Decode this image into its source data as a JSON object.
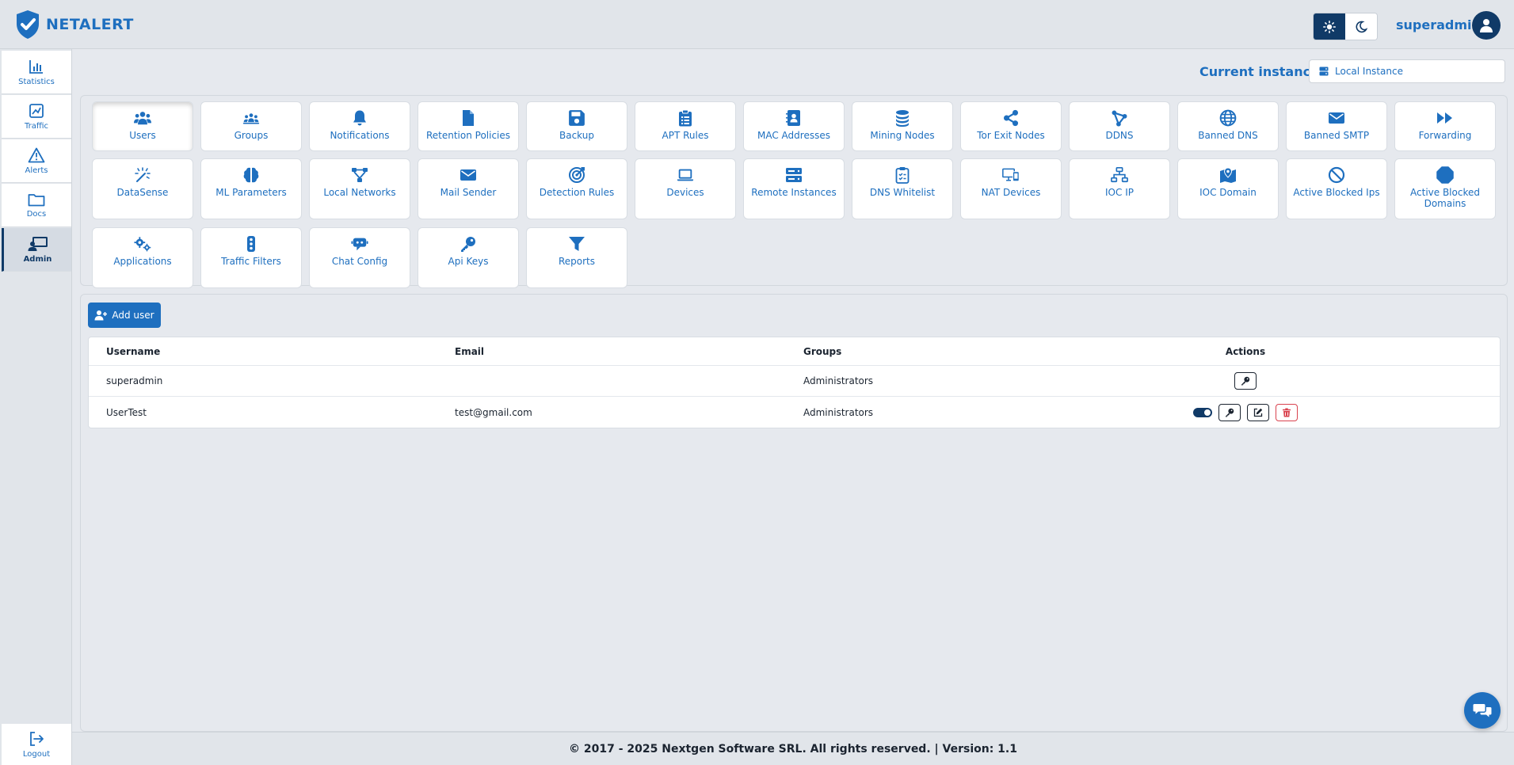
{
  "app": {
    "logo_text": "NETALERT"
  },
  "header": {
    "username": "superadmin"
  },
  "sidebar": {
    "items": [
      {
        "label": "Statistics",
        "icon": "chart-bar-icon"
      },
      {
        "label": "Traffic",
        "icon": "chart-line-icon"
      },
      {
        "label": "Alerts",
        "icon": "warning-icon"
      },
      {
        "label": "Docs",
        "icon": "folder-icon"
      },
      {
        "label": "Admin",
        "icon": "admin-screen-icon",
        "active": true
      }
    ],
    "logout_label": "Logout"
  },
  "instance": {
    "label": "Current instance:",
    "value": "Local Instance"
  },
  "tiles": [
    {
      "label": "Users",
      "icon": "users-icon",
      "active": true
    },
    {
      "label": "Groups",
      "icon": "groups-icon"
    },
    {
      "label": "Notifications",
      "icon": "bell-icon"
    },
    {
      "label": "Retention Policies",
      "icon": "file-icon"
    },
    {
      "label": "Backup",
      "icon": "floppy-icon"
    },
    {
      "label": "APT Rules",
      "icon": "clipboard-icon"
    },
    {
      "label": "MAC Addresses",
      "icon": "address-book-icon"
    },
    {
      "label": "Mining Nodes",
      "icon": "coins-icon"
    },
    {
      "label": "Tor Exit Nodes",
      "icon": "share-nodes-icon"
    },
    {
      "label": "DDNS",
      "icon": "vector-icon"
    },
    {
      "label": "Banned DNS",
      "icon": "globe-icon"
    },
    {
      "label": "Banned SMTP",
      "icon": "envelope-icon"
    },
    {
      "label": "Forwarding",
      "icon": "forward-icon"
    },
    {
      "label": "DataSense",
      "icon": "wand-icon"
    },
    {
      "label": "ML Parameters",
      "icon": "brain-icon"
    },
    {
      "label": "Local Networks",
      "icon": "network-diagram-icon"
    },
    {
      "label": "Mail Sender",
      "icon": "envelope-icon"
    },
    {
      "label": "Detection Rules",
      "icon": "target-icon"
    },
    {
      "label": "Devices",
      "icon": "laptop-icon"
    },
    {
      "label": "Remote Instances",
      "icon": "server-icon"
    },
    {
      "label": "DNS Whitelist",
      "icon": "clipboard-check-icon"
    },
    {
      "label": "NAT Devices",
      "icon": "desktop-mobile-icon"
    },
    {
      "label": "IOC IP",
      "icon": "sitemap-icon"
    },
    {
      "label": "IOC Domain",
      "icon": "map-marker-icon"
    },
    {
      "label": "Active Blocked Ips",
      "icon": "ban-icon"
    },
    {
      "label": "Active Blocked Domains",
      "icon": "octagon-icon"
    },
    {
      "label": "Applications",
      "icon": "gears-icon"
    },
    {
      "label": "Traffic Filters",
      "icon": "traffic-light-icon"
    },
    {
      "label": "Chat Config",
      "icon": "robot-chat-icon"
    },
    {
      "label": "Api Keys",
      "icon": "key-icon"
    },
    {
      "label": "Reports",
      "icon": "filter-icon"
    }
  ],
  "users": {
    "add_label": "Add user",
    "columns": [
      "Username",
      "Email",
      "Groups",
      "Actions"
    ],
    "rows": [
      {
        "username": "superadmin",
        "email": "",
        "groups": "Administrators",
        "actions": [
          "key"
        ]
      },
      {
        "username": "UserTest",
        "email": "test@gmail.com",
        "groups": "Administrators",
        "actions": [
          "toggle",
          "key",
          "edit",
          "delete"
        ]
      }
    ]
  },
  "footer": {
    "text": "© 2017 - 2025 Nextgen Software SRL. All rights reserved. | Version: 1.1"
  },
  "colors": {
    "accent": "#1e6fbf",
    "dark": "#103a67",
    "danger": "#d9434f",
    "background": "#e6e9ee"
  }
}
